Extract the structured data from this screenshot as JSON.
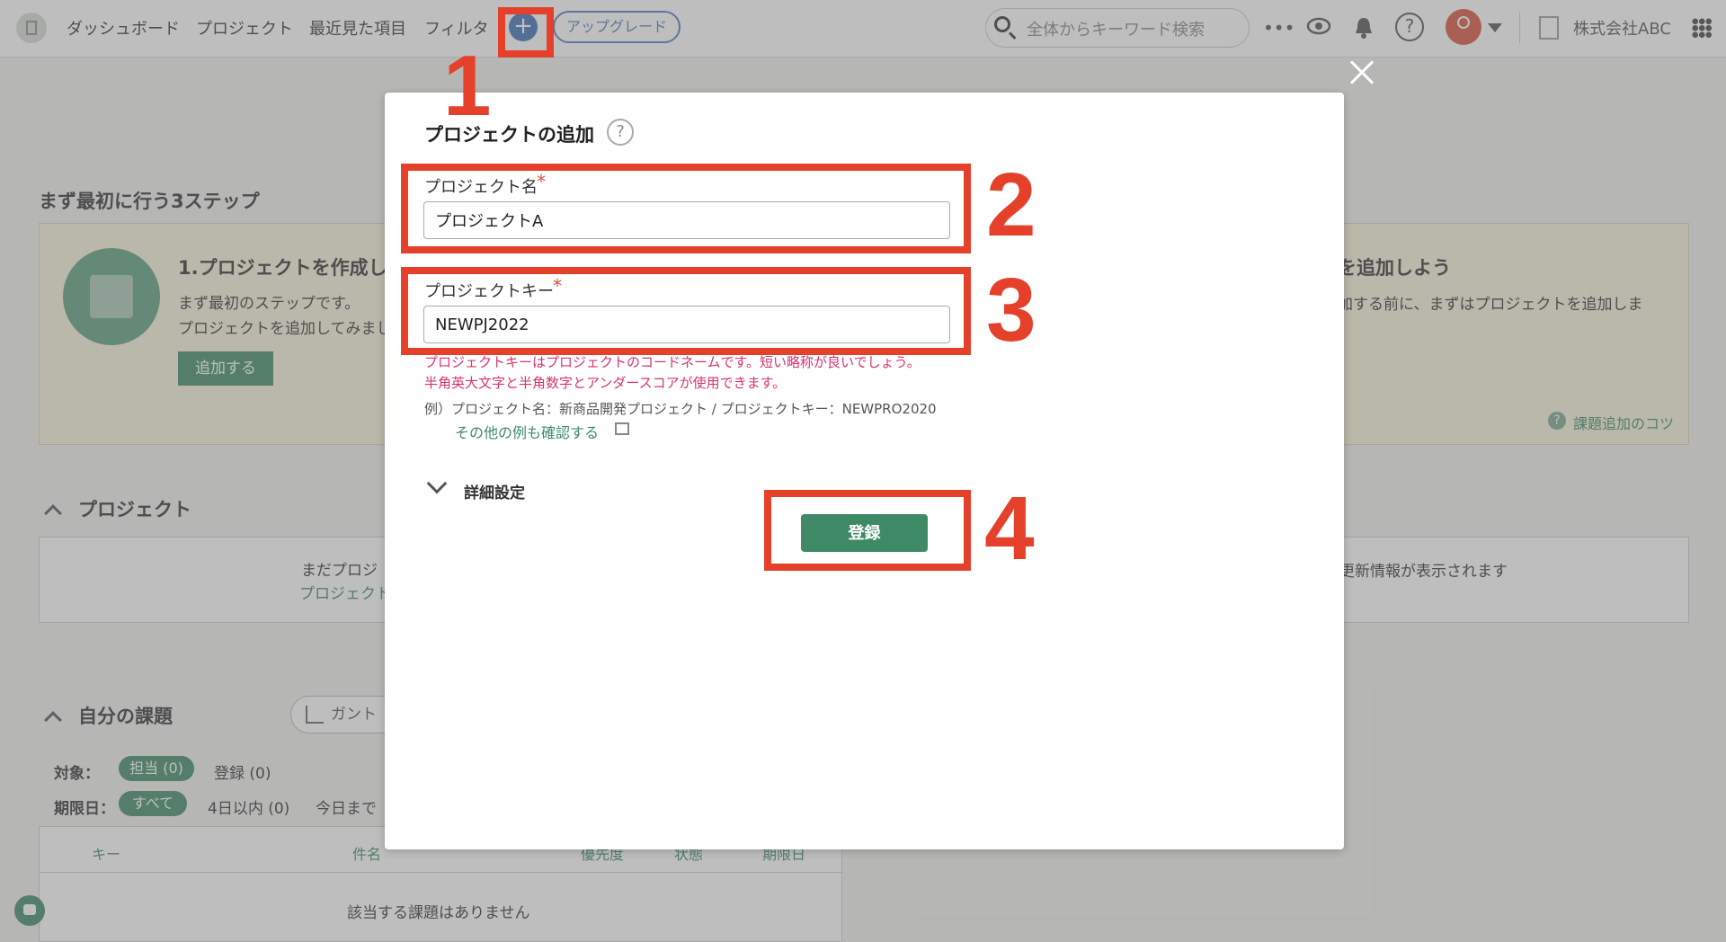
{
  "header": {
    "nav": [
      "ダッシュボード",
      "プロジェクト",
      "最近見た項目",
      "フィルタ"
    ],
    "add_label": "+",
    "upgrade_label": "アップグレード",
    "search_placeholder": "全体からキーワード検索",
    "more_label": "•••",
    "help_label": "?",
    "company": "株式会社ABC"
  },
  "background": {
    "steps_title": "まず最初に行う3ステップ",
    "step1": {
      "title": "1.プロジェクトを作成し",
      "desc_line1": "まず最初のステップです。",
      "desc_line2": "プロジェクトを追加してみまし",
      "button": "追加する"
    },
    "step_right": {
      "title": "を追加しよう",
      "desc": "加する前に、まずはプロジェクトを追加しま",
      "tips_label": "?",
      "tips": "課題追加のコツ"
    },
    "projects": {
      "title": "プロジェクト",
      "empty_line1": "まだプロジ",
      "empty_line2": "プロジェクト",
      "right_text": "更新情報が表示されます"
    },
    "my_tasks": {
      "title": "自分の課題",
      "gantt_label": "ガント",
      "target_label": "対象：",
      "assigned": "担当 (0)",
      "registered": "登録 (0)",
      "due_label": "期限日：",
      "all": "すべて",
      "within4": "4日以内 (0)",
      "today": "今日まで",
      "columns": [
        "キー",
        "件名",
        "優先度",
        "状態",
        "期限日"
      ],
      "empty": "該当する課題はありません"
    }
  },
  "modal": {
    "title": "プロジェクトの追加",
    "help_label": "?",
    "project_name_label": "プロジェクト名",
    "project_name_value": "プロジェクトA",
    "project_key_label": "プロジェクトキー",
    "project_key_value": "NEWPJ2022",
    "required_mark": "*",
    "hint_red_1": "プロジェクトキーはプロジェクトのコードネームです。短い略称が良いでしょう。",
    "hint_red_2": "半角英大文字と半角数字とアンダースコアが使用できます。",
    "hint_example": "例）プロジェクト名：新商品開発プロジェクト / プロジェクトキー：NEWPRO2020",
    "hint_link": "その他の例も確認する",
    "advanced_label": "詳細設定",
    "submit_label": "登録"
  },
  "annotations": [
    "1",
    "2",
    "3",
    "4"
  ],
  "colors": {
    "annotation": "#e5402a",
    "accent": "#3e8a66",
    "required": "#d9533c",
    "hint": "#d9336c"
  }
}
